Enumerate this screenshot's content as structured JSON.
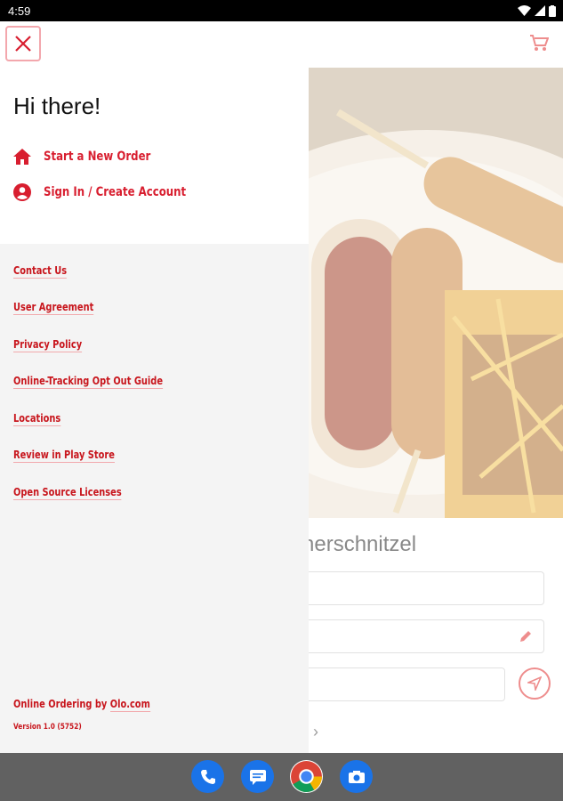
{
  "status_bar": {
    "time": "4:59"
  },
  "background": {
    "restaurant_name": "nerschnitzel",
    "cart_icon": "cart-icon",
    "colors": {
      "accent": "#e23b3b"
    }
  },
  "drawer": {
    "greeting": "Hi there!",
    "main_links": [
      {
        "icon": "home-icon",
        "label": "Start a New Order"
      },
      {
        "icon": "account-circle-icon",
        "label": "Sign In / Create Account"
      }
    ],
    "footer_links": [
      "Contact Us",
      "User Agreement",
      "Privacy Policy",
      "Online-Tracking Opt Out Guide",
      "Locations",
      "Review in Play Store",
      "Open Source Licenses"
    ],
    "powered_by_prefix": "Online Ordering by ",
    "powered_by_link": "Olo.com",
    "version": "Version 1.0 (5752)",
    "colors": {
      "brand_red": "#d81e2f",
      "underline": "#f2a9ad"
    }
  },
  "dock": {
    "apps": [
      "phone-icon",
      "messages-icon",
      "chrome-icon",
      "camera-icon"
    ]
  }
}
